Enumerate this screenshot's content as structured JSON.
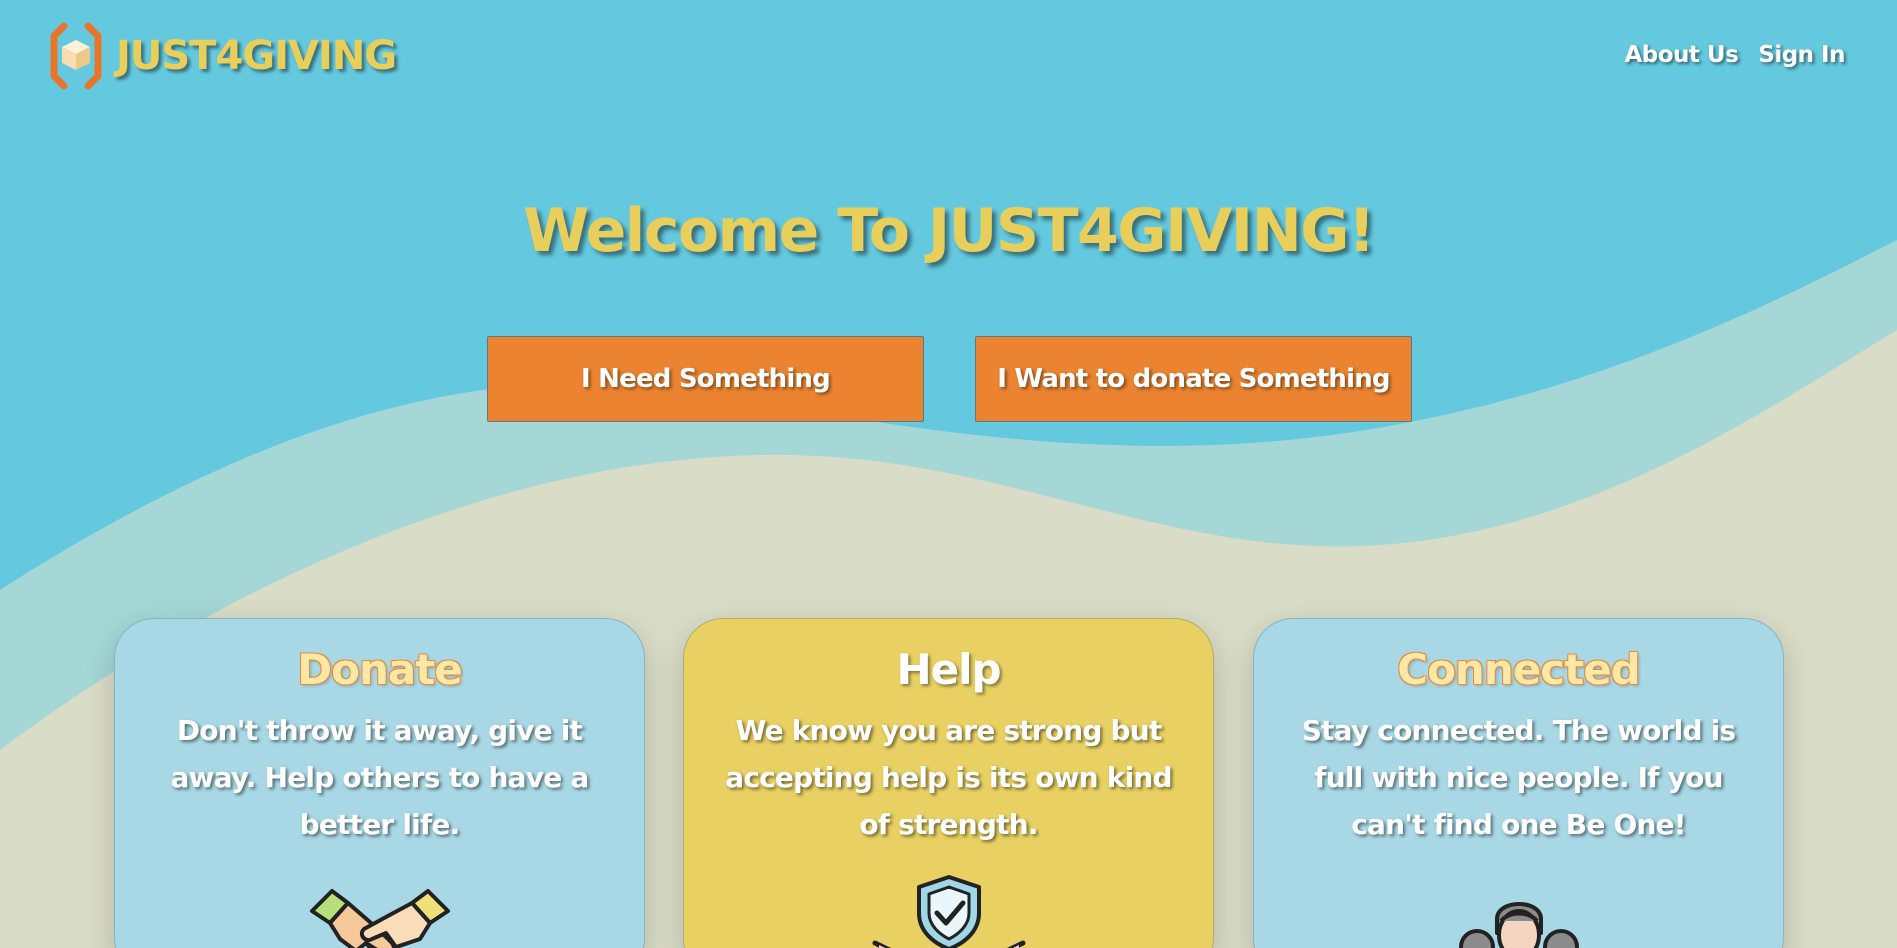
{
  "header": {
    "brand": "JUST4GIVING",
    "logo_icon": "box-in-hands-icon",
    "nav": {
      "about_label": "About Us",
      "signin_label": "Sign In"
    }
  },
  "hero": {
    "title": "Welcome To JUST4GIVING!",
    "need_button_label": "I Need Something",
    "donate_button_label": "I Want to donate Something"
  },
  "cards": [
    {
      "title": "Donate",
      "text": "Don't throw it away, give it away. Help others to have a better life.",
      "icon": "handshake-icon"
    },
    {
      "title": "Help",
      "text": "We know you are strong but accepting help is its own kind of strength.",
      "icon": "shield-check-icon"
    },
    {
      "title": "Connected",
      "text": "Stay connected. The world is full with nice people. If you can't find one Be One!",
      "icon": "people-group-icon"
    }
  ],
  "colors": {
    "sky": "#64c9df",
    "sand": "#d9dcc6",
    "mid_wave": "#a4d7d6",
    "accent_orange": "#eb8330",
    "brand_yellow": "#e8cf5c",
    "card_blue": "#a8d8e6",
    "card_yellow": "#e8d062"
  }
}
